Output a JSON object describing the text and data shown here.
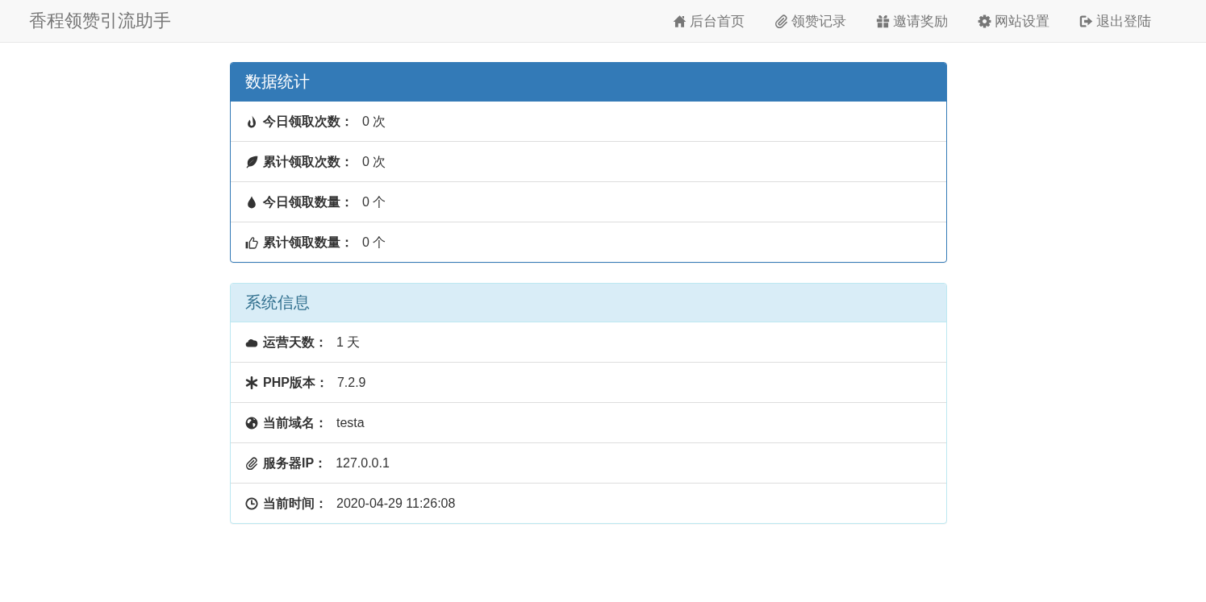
{
  "navbar": {
    "brand": "香程领赞引流助手",
    "items": [
      {
        "label": "后台首页",
        "selected": false
      },
      {
        "label": "领赞记录",
        "selected": false
      },
      {
        "label": "邀请奖励",
        "selected": false
      },
      {
        "label": "网站设置",
        "selected": false
      },
      {
        "label": "退出登陆",
        "selected": false
      }
    ]
  },
  "panels": [
    {
      "kind": "primary",
      "title": "数据统计",
      "rows": [
        {
          "label": "今日领取次数：",
          "value": "0 次"
        },
        {
          "label": "累计领取次数：",
          "value": "0 次"
        },
        {
          "label": "今日领取数量：",
          "value": "0 个"
        },
        {
          "label": "累计领取数量：",
          "value": "0 个"
        }
      ]
    },
    {
      "kind": "info",
      "title": "系统信息",
      "rows": [
        {
          "label": "运营天数：",
          "value": "1 天"
        },
        {
          "label": "PHP版本：",
          "value": "7.2.9"
        },
        {
          "label": "当前域名：",
          "value": "testa"
        },
        {
          "label": "服务器IP：",
          "value": "127.0.0.1"
        },
        {
          "label": "当前时间：",
          "value": "2020-04-29 11:26:08"
        }
      ]
    }
  ]
}
